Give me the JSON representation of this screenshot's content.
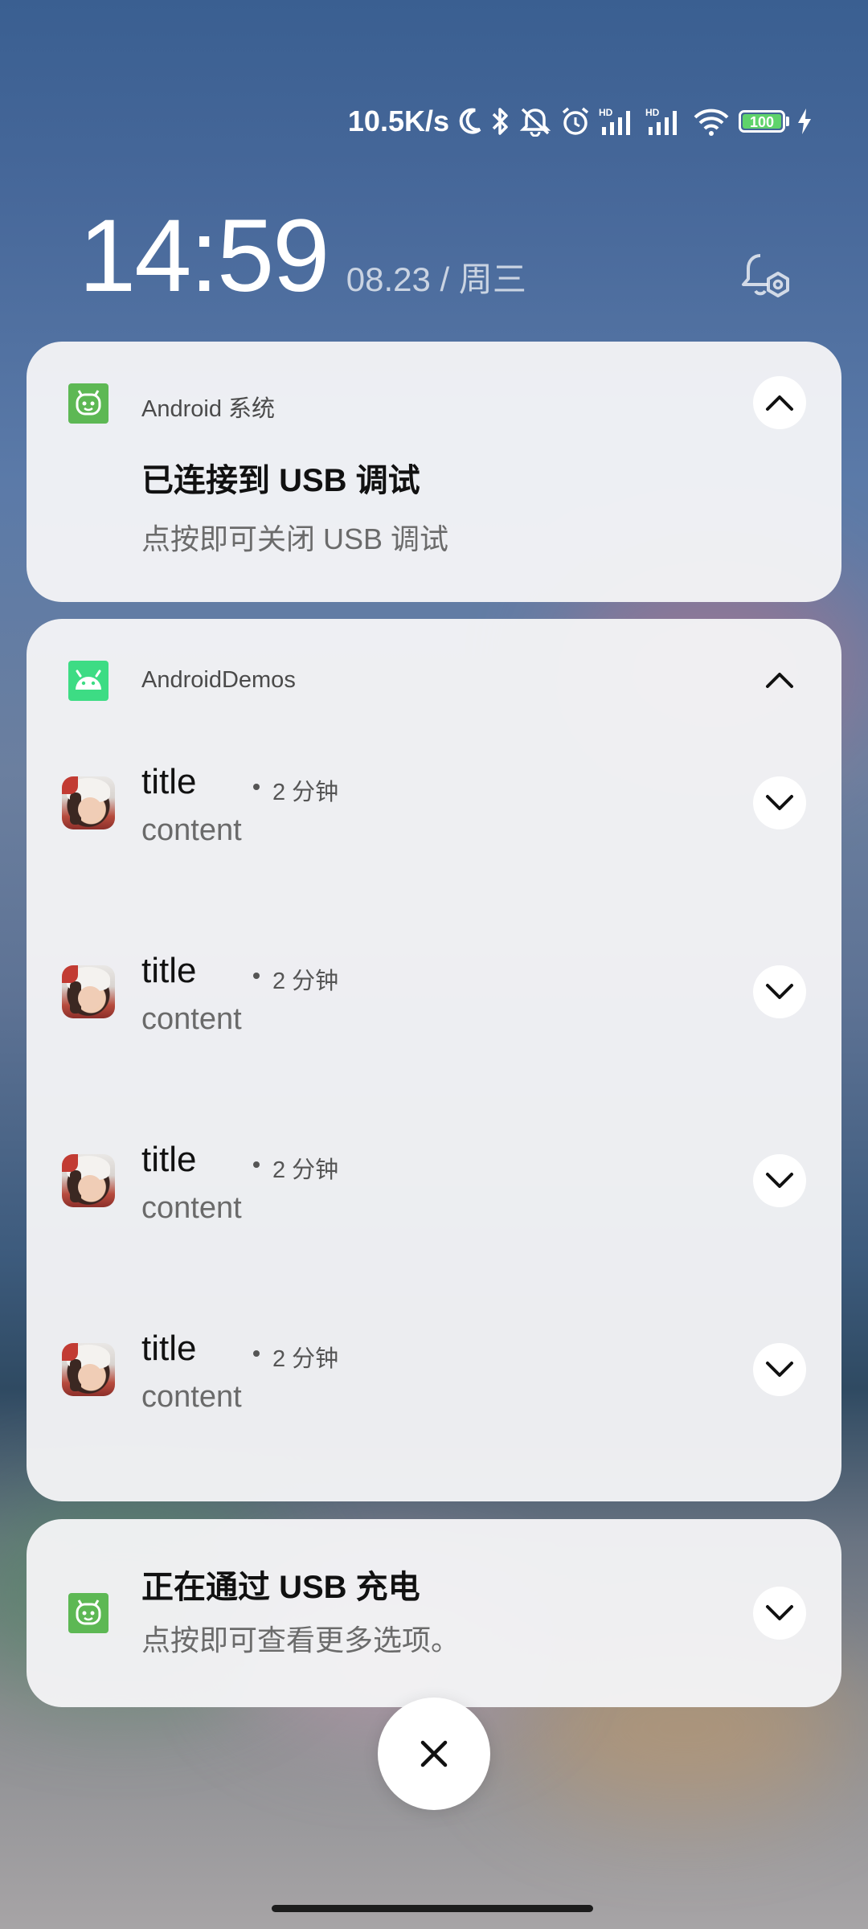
{
  "status_bar": {
    "net_speed": "10.5K/s",
    "battery_level": "100",
    "icons": [
      "moon-icon",
      "bluetooth-icon",
      "mute-vibrate-icon",
      "alarm-icon",
      "hd-signal-icon",
      "hd-signal-icon",
      "wifi-icon",
      "battery-icon",
      "charging-bolt-icon"
    ],
    "battery_color": "#5fd36b"
  },
  "header": {
    "time": "14:59",
    "date": "08.23 / 周三",
    "settings_icon": "notification-settings-icon"
  },
  "notifications": {
    "system": {
      "app_name": "Android 系统",
      "title": "已连接到 USB 调试",
      "text": "点按即可关闭 USB 调试",
      "icon": "android-system-icon",
      "icon_color": "#5db854"
    },
    "group": {
      "app_name": "AndroidDemos",
      "icon": "android-icon",
      "icon_color": "#3ddc84",
      "items": [
        {
          "title": "title",
          "time": "2 分钟",
          "content": "content"
        },
        {
          "title": "title",
          "time": "2 分钟",
          "content": "content"
        },
        {
          "title": "title",
          "time": "2 分钟",
          "content": "content"
        },
        {
          "title": "title",
          "time": "2 分钟",
          "content": "content"
        }
      ]
    },
    "charging": {
      "title": "正在通过 USB 充电",
      "text": "点按即可查看更多选项。",
      "icon": "android-system-icon",
      "icon_color": "#5db854"
    }
  },
  "controls": {
    "dismiss_all_icon": "close-icon"
  }
}
